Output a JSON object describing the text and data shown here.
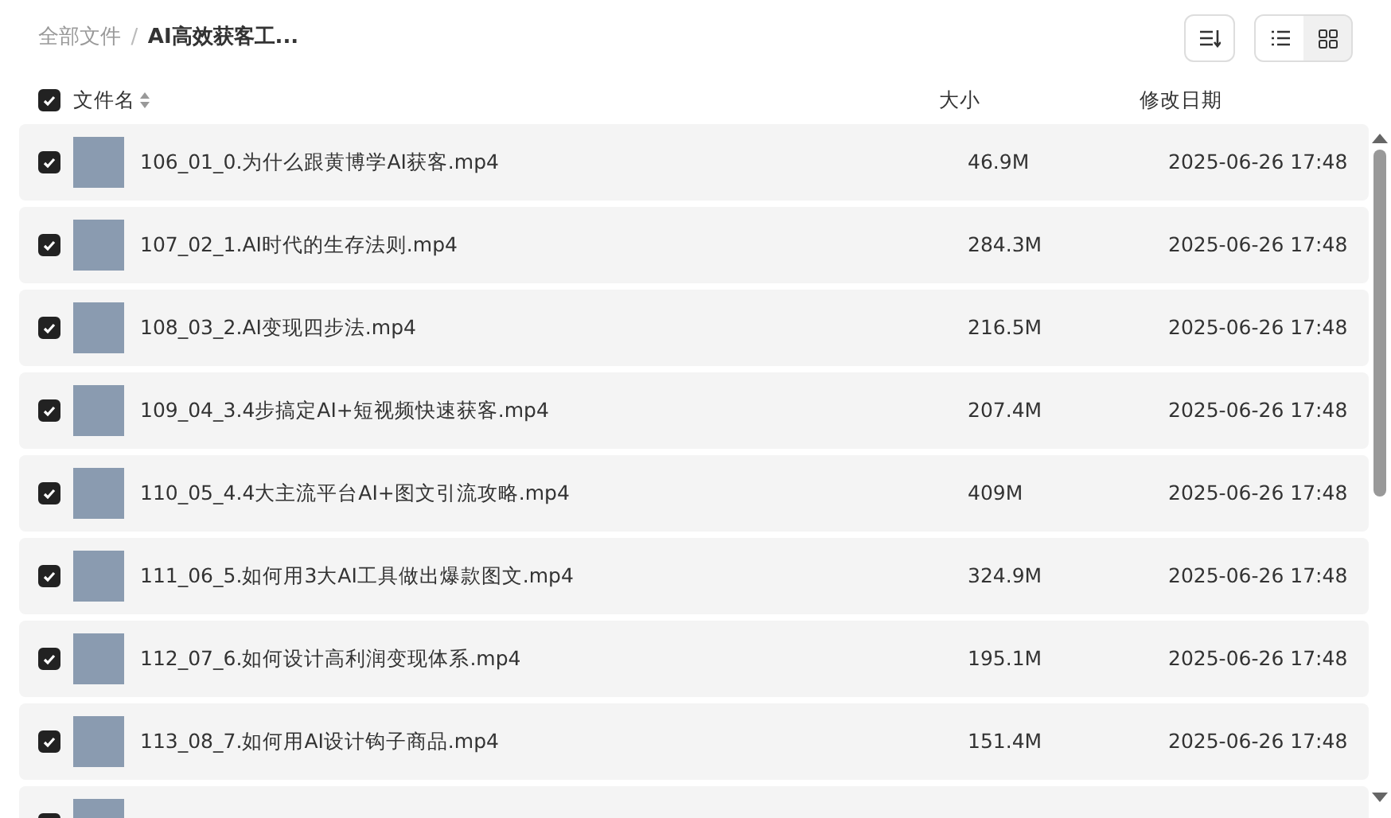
{
  "breadcrumb_separator": "/",
  "breadcrumb": [
    {
      "label": "全部文件",
      "current": false
    },
    {
      "label": "AI高效获客工...",
      "current": true
    }
  ],
  "view_buttons": [
    {
      "kind": "list",
      "selected": true
    },
    {
      "kind": "grid",
      "selected": false
    }
  ],
  "header": {
    "checked": true,
    "name": "文件名",
    "size": "大小",
    "date": "修改日期"
  },
  "files": [
    {
      "checked": true,
      "name": "106_01_0.为什么跟黄博学AI获客.mp4",
      "size": "46.9M",
      "date": "2025-06-26 17:48"
    },
    {
      "checked": true,
      "name": "107_02_1.AI时代的生存法则.mp4",
      "size": "284.3M",
      "date": "2025-06-26 17:48"
    },
    {
      "checked": true,
      "name": "108_03_2.AI变现四步法.mp4",
      "size": "216.5M",
      "date": "2025-06-26 17:48"
    },
    {
      "checked": true,
      "name": "109_04_3.4步搞定AI+短视频快速获客.mp4",
      "size": "207.4M",
      "date": "2025-06-26 17:48"
    },
    {
      "checked": true,
      "name": "110_05_4.4大主流平台AI+图文引流攻略.mp4",
      "size": "409M",
      "date": "2025-06-26 17:48"
    },
    {
      "checked": true,
      "name": "111_06_5.如何用3大AI工具做出爆款图文.mp4",
      "size": "324.9M",
      "date": "2025-06-26 17:48"
    },
    {
      "checked": true,
      "name": "112_07_6.如何设计高利润变现体系.mp4",
      "size": "195.1M",
      "date": "2025-06-26 17:48"
    },
    {
      "checked": true,
      "name": "113_08_7.如何用AI设计钩子商品.mp4",
      "size": "151.4M",
      "date": "2025-06-26 17:48"
    },
    {
      "checked": true
    }
  ]
}
